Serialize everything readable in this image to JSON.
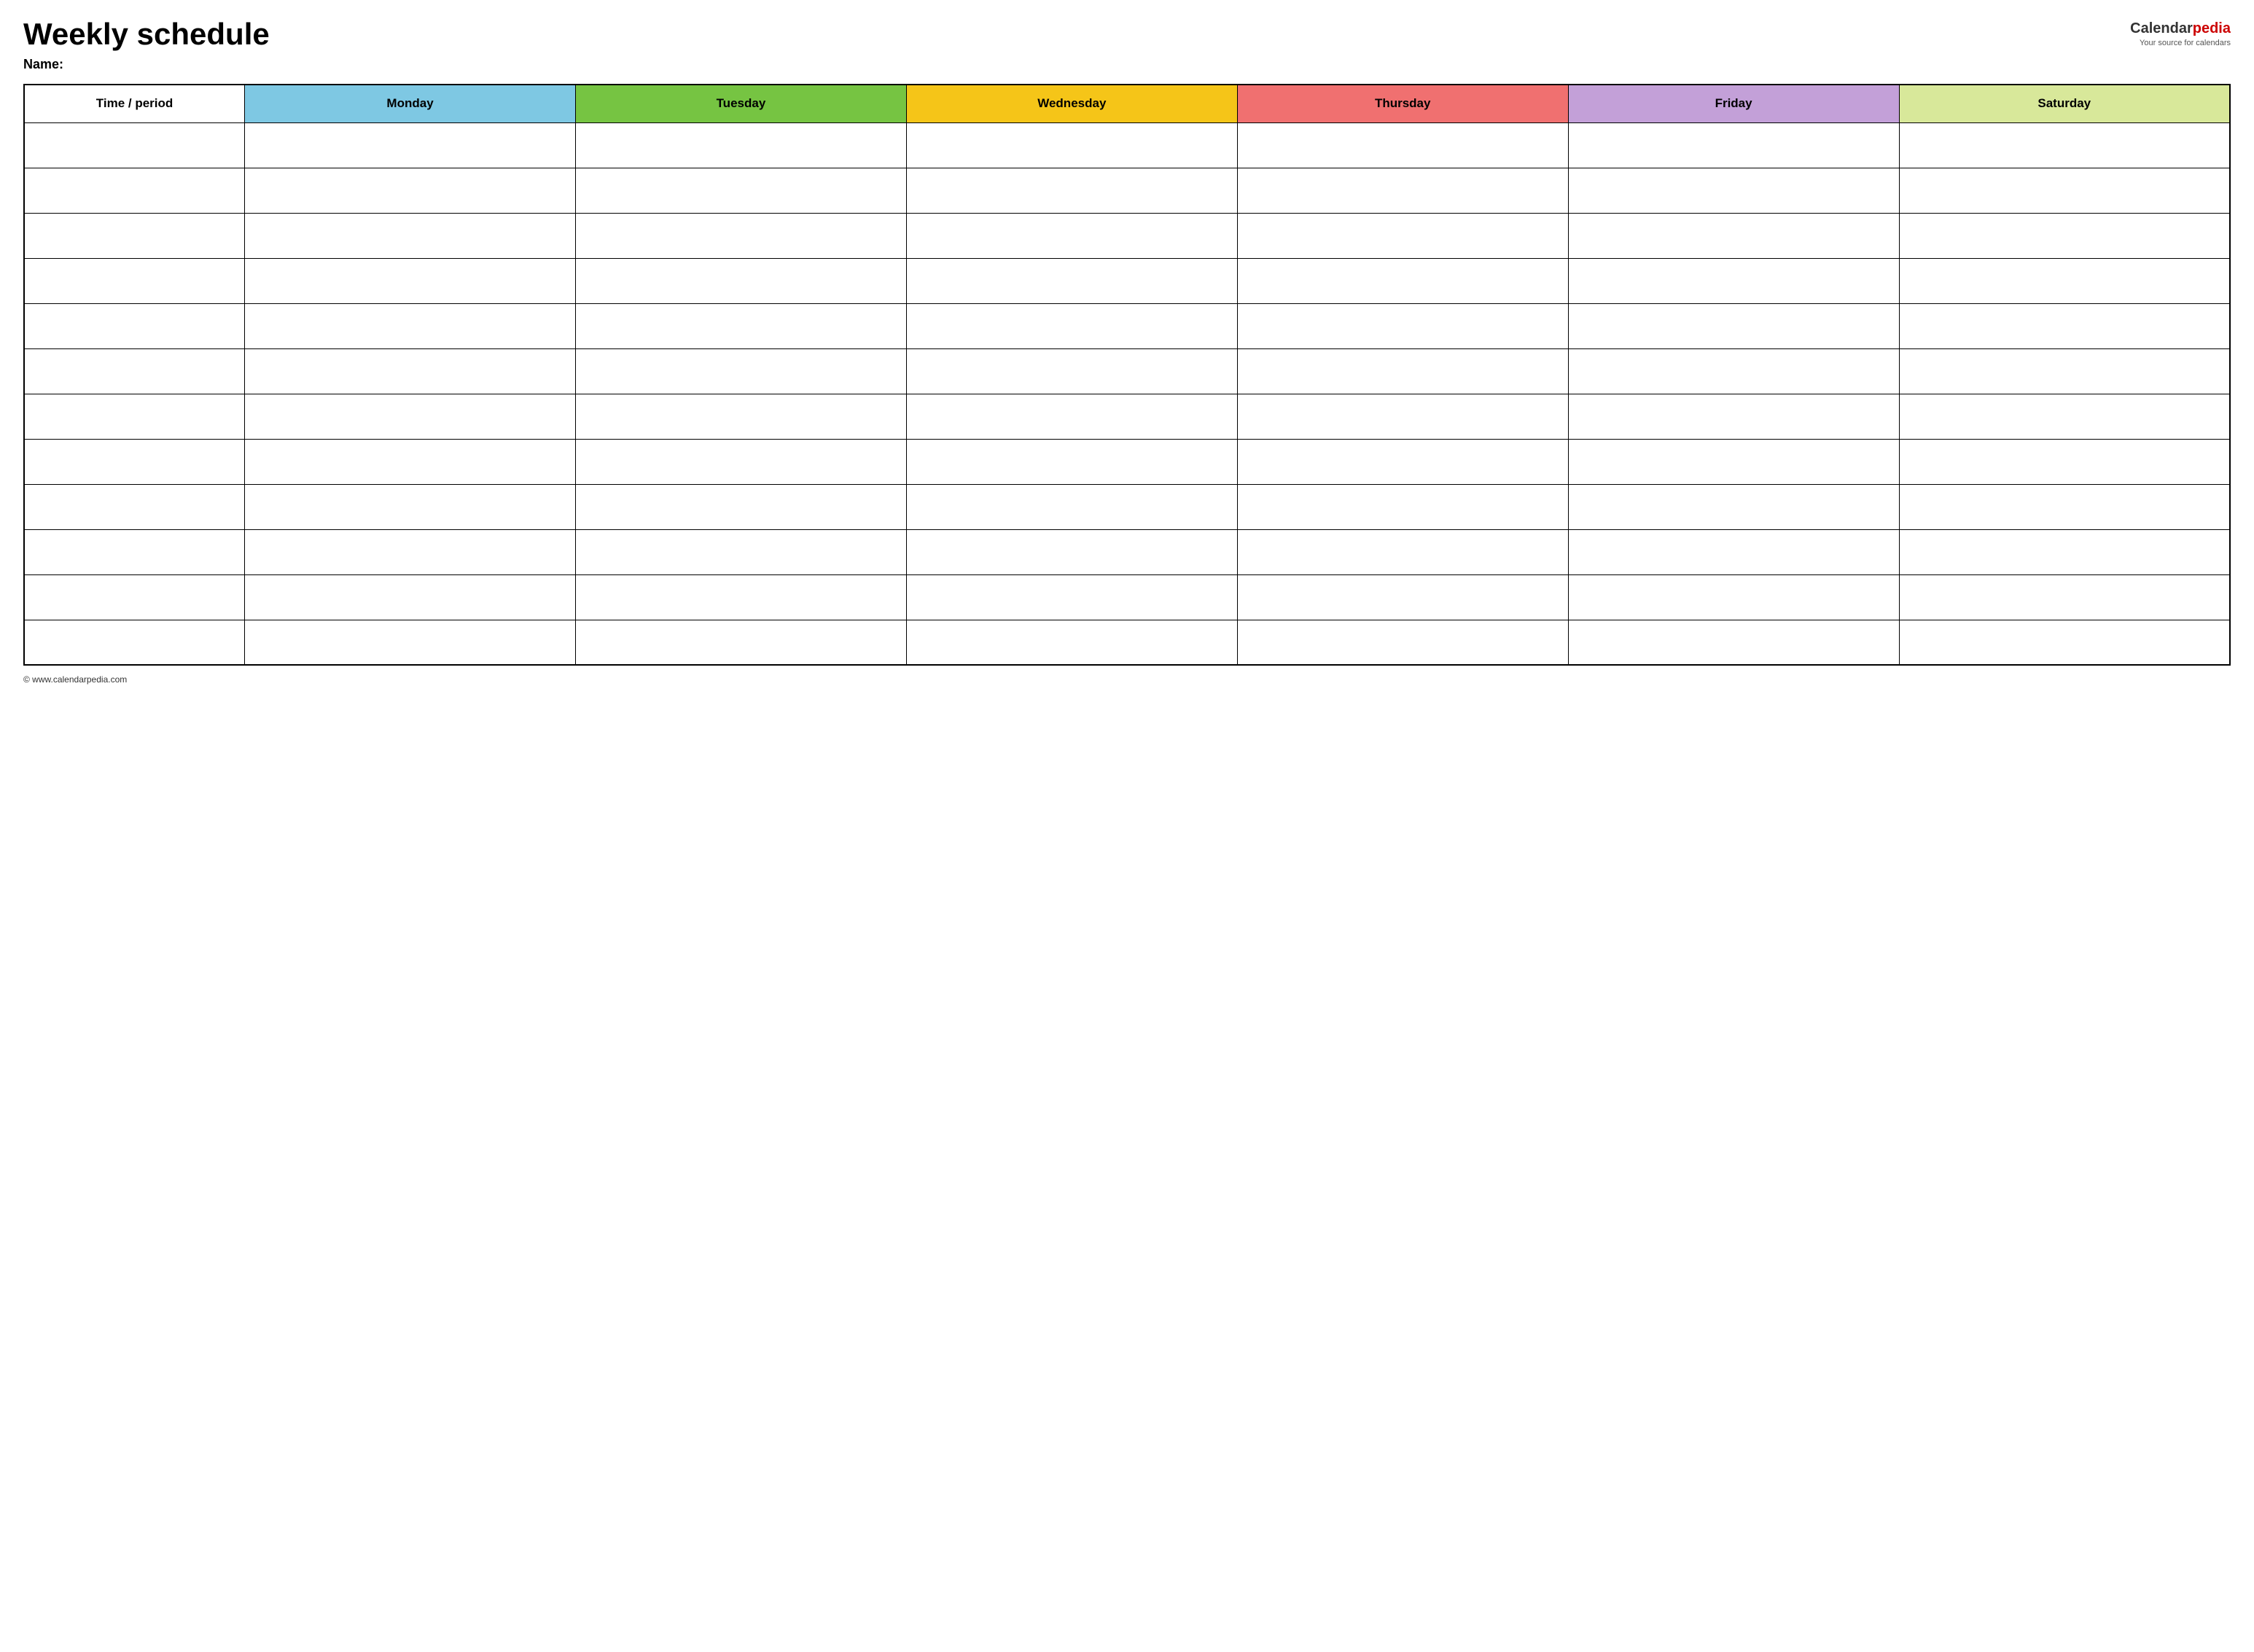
{
  "header": {
    "title": "Weekly schedule",
    "name_label": "Name:",
    "logo": {
      "calendar": "Calendar",
      "pedia": "pedia",
      "tagline": "Your source for calendars"
    }
  },
  "table": {
    "headers": [
      {
        "id": "time-period",
        "label": "Time / period",
        "class": "time-header"
      },
      {
        "id": "monday",
        "label": "Monday",
        "class": "monday"
      },
      {
        "id": "tuesday",
        "label": "Tuesday",
        "class": "tuesday"
      },
      {
        "id": "wednesday",
        "label": "Wednesday",
        "class": "wednesday"
      },
      {
        "id": "thursday",
        "label": "Thursday",
        "class": "thursday"
      },
      {
        "id": "friday",
        "label": "Friday",
        "class": "friday"
      },
      {
        "id": "saturday",
        "label": "Saturday",
        "class": "saturday"
      }
    ],
    "row_count": 12
  },
  "footer": {
    "url": "© www.calendarpedia.com"
  }
}
